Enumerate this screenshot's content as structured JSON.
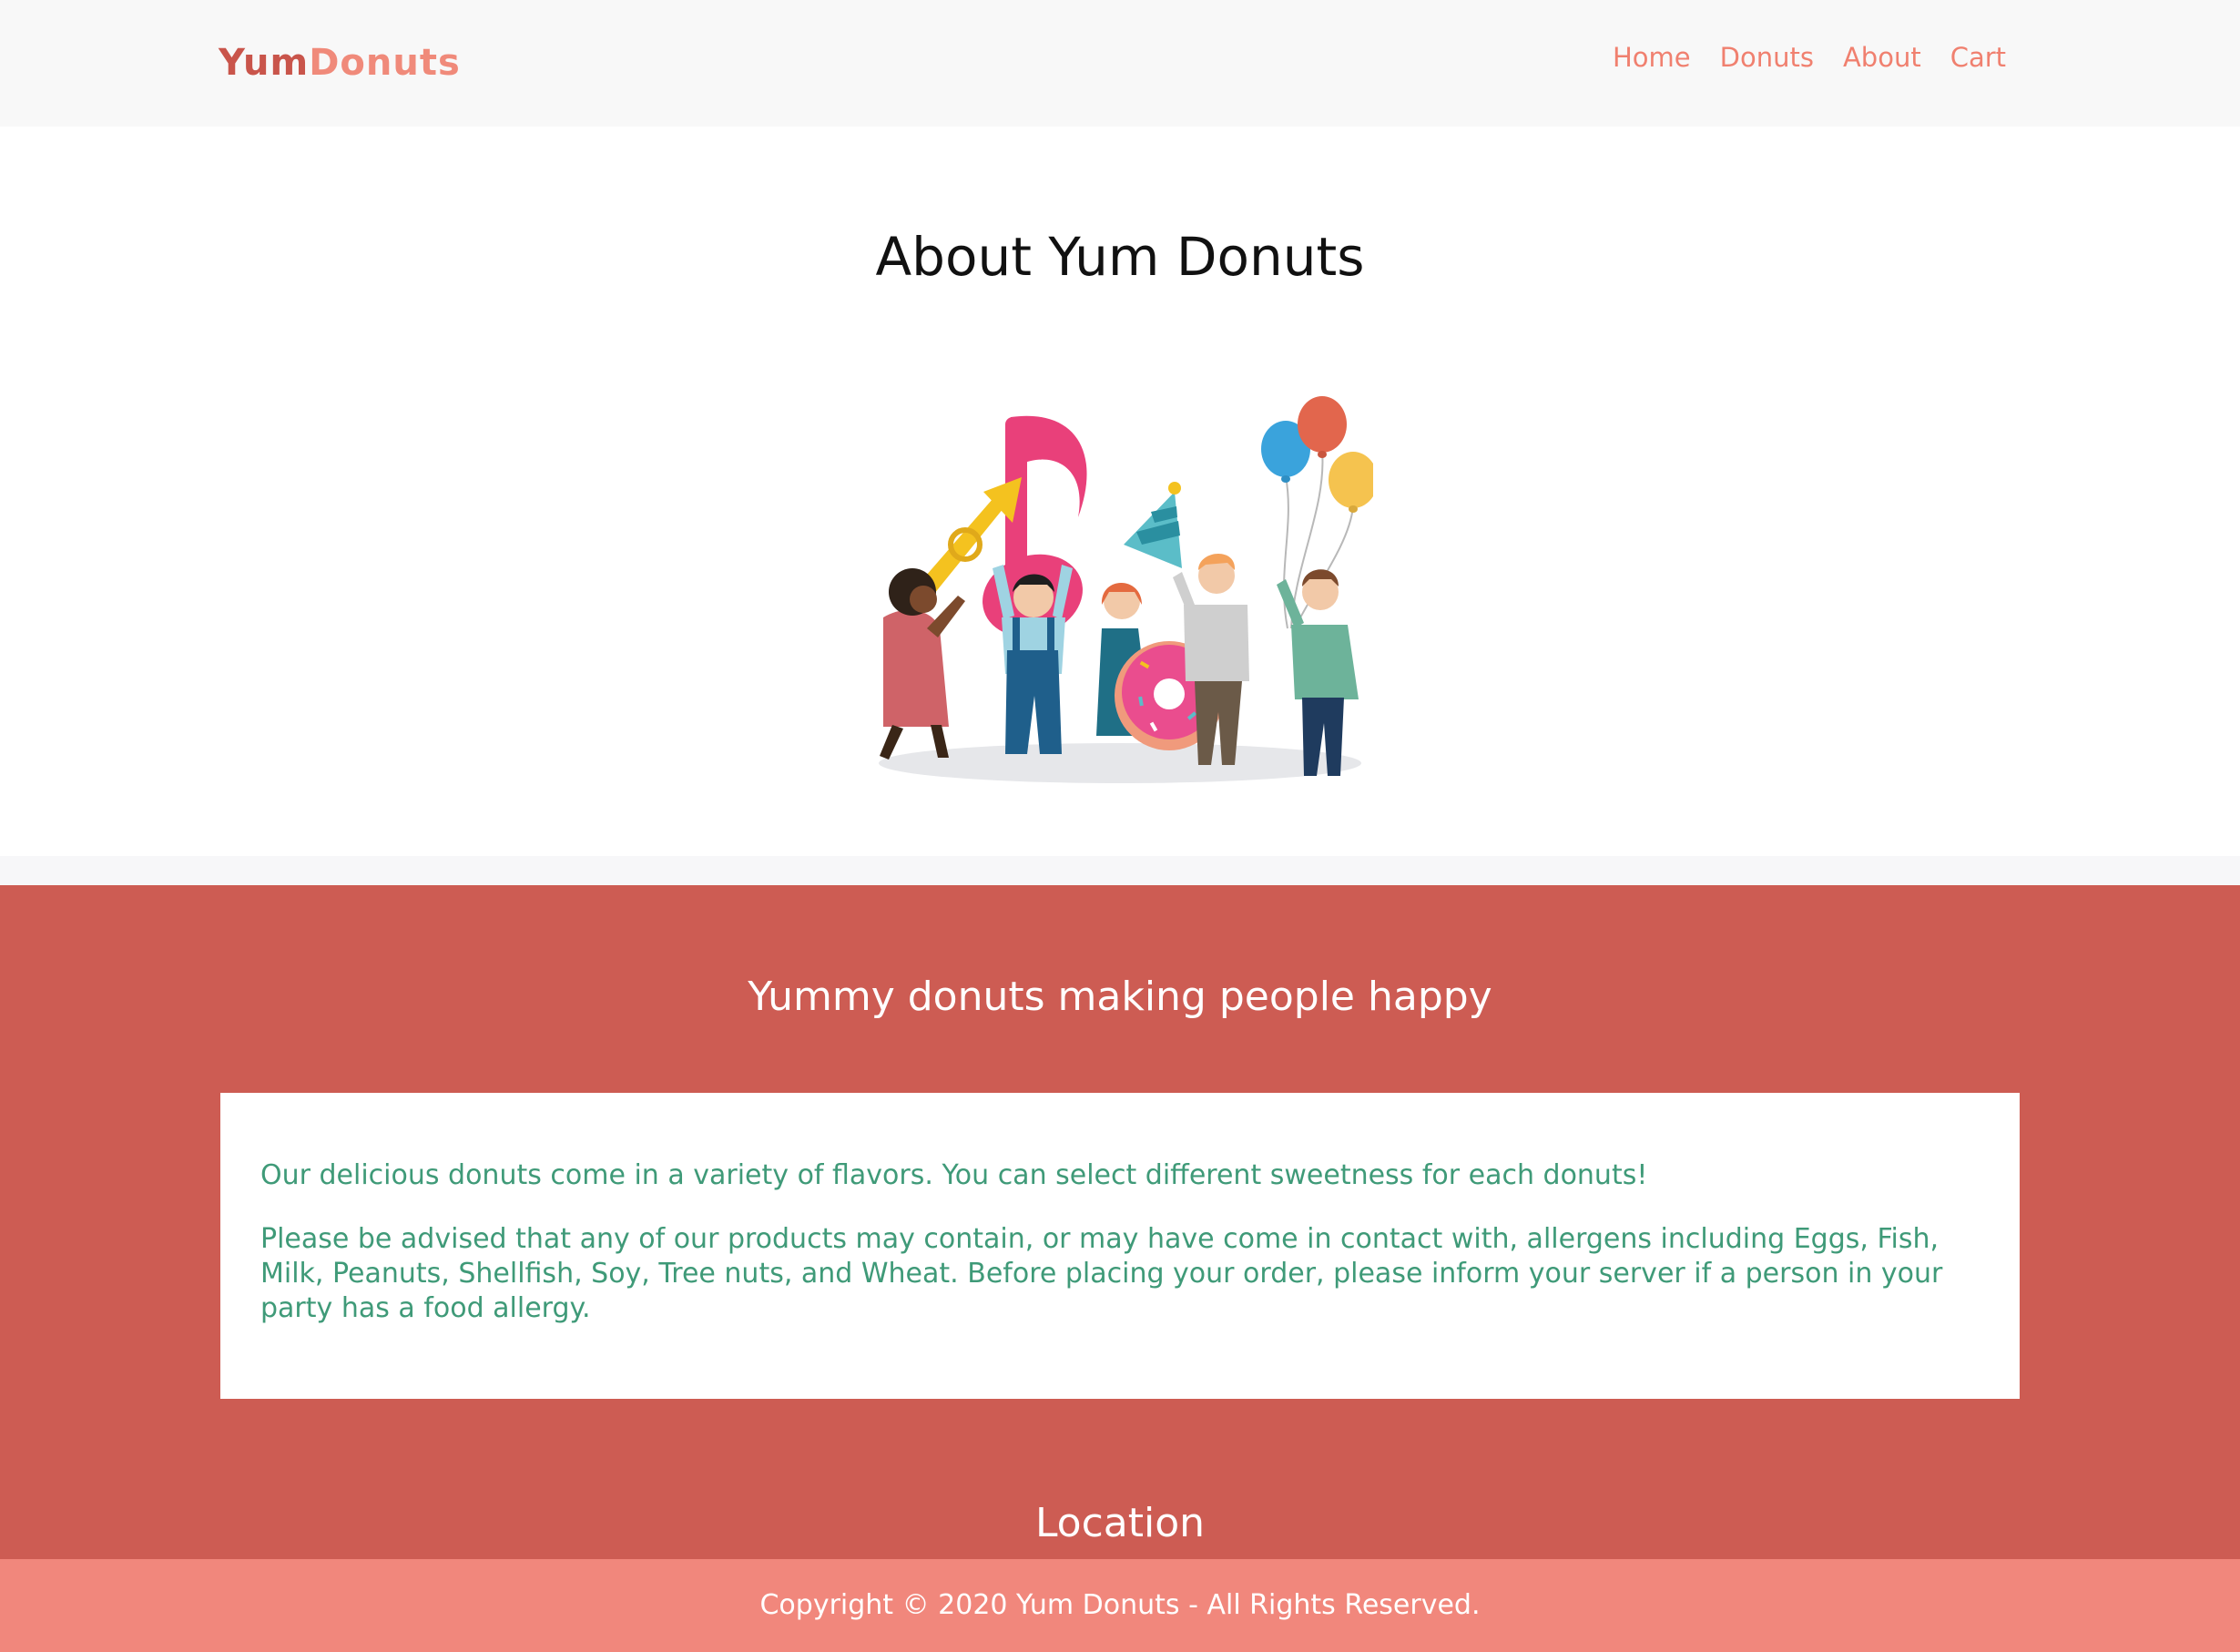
{
  "brand": {
    "part1": "Yum",
    "part2": "Donuts"
  },
  "nav": {
    "items": [
      {
        "label": "Home"
      },
      {
        "label": "Donuts"
      },
      {
        "label": "About"
      },
      {
        "label": "Cart"
      }
    ]
  },
  "hero": {
    "title": "About Yum Donuts"
  },
  "about": {
    "heading": "Yummy donuts making people happy",
    "paragraphs": [
      "Our delicious donuts come in a variety of flavors. You can select different sweetness for each donuts!",
      "Please be advised that any of our products may contain, or may have come in contact with, allergens including Eggs, Fish, Milk, Peanuts, Shellfish, Soy, Tree nuts, and Wheat. Before placing your order, please inform your server if a person in your party has a food allergy."
    ]
  },
  "location": {
    "heading": "Location"
  },
  "footer": {
    "copyright": "Copyright © 2020 Yum Donuts - All Rights Reserved."
  },
  "colors": {
    "brand_dark": "#c9554b",
    "brand_light": "#f08a7a",
    "nav_link": "#f0806f",
    "section_red": "#cd5c53",
    "footer_pink": "#f1877c",
    "body_green": "#3f9a78"
  }
}
